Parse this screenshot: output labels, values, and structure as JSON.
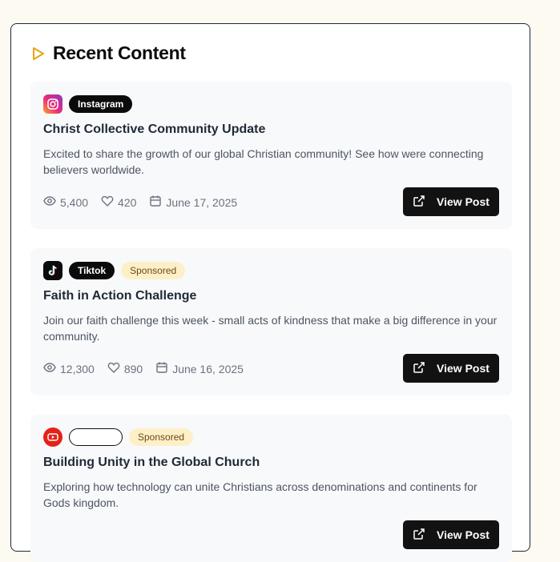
{
  "section": {
    "title": "Recent Content"
  },
  "posts": [
    {
      "platform": "Instagram",
      "sponsored": null,
      "title": "Christ Collective Community Update",
      "description": "Excited to share the growth of our global Christian community! See how were connecting believers worldwide.",
      "views": "5,400",
      "likes": "420",
      "date": "June 17, 2025",
      "action": "View Post"
    },
    {
      "platform": "Tiktok",
      "sponsored": "Sponsored",
      "title": "Faith in Action Challenge",
      "description": "Join our faith challenge this week - small acts of kindness that make a big difference in your community.",
      "views": "12,300",
      "likes": "890",
      "date": "June 16, 2025",
      "action": "View Post"
    },
    {
      "platform": "",
      "sponsored": "Sponsored",
      "title": "Building Unity in the Global Church",
      "description": "Exploring how technology can unite Christians across denominations and continents for Gods kingdom.",
      "action": "View Post"
    }
  ],
  "colors": {
    "accent": "#e8a317",
    "button": "#121212",
    "sponsored_bg": "#fdf0c8",
    "youtube": "#e62117"
  }
}
